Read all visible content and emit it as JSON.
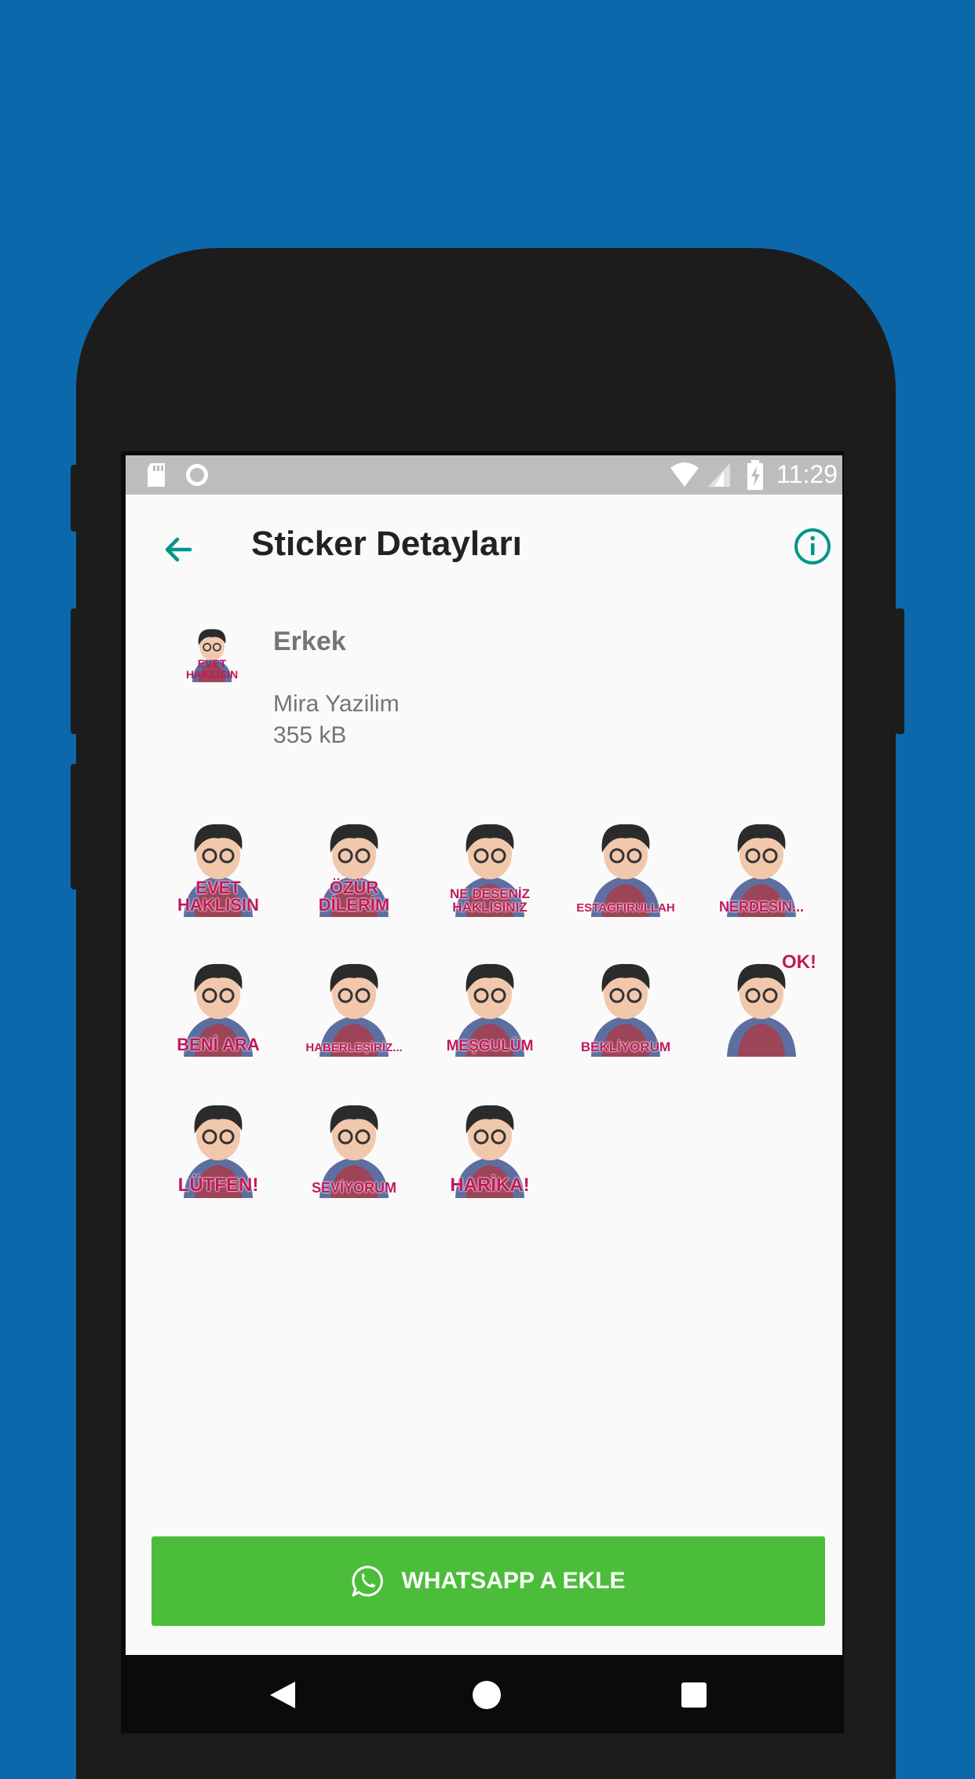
{
  "status_bar": {
    "time": "11:29"
  },
  "toolbar": {
    "title": "Sticker Detayları"
  },
  "pack": {
    "name": "Erkek",
    "publisher": "Mira Yazilim",
    "size": "355 kB",
    "tray_caption": "EVET HAKLISIN"
  },
  "stickers": [
    "EVET HAKLISIN",
    "ÖZÜR DİLERİM",
    "NE DESENİZ HAKLISINIZ",
    "ESTAGFIRULLAH",
    "NERDESİN...",
    "BENİ ARA",
    "HABERLEŞİRİZ...",
    "MEŞGULÜM",
    "BEKLİYORUM",
    "OK!",
    "LÜTFEN!",
    "SEVİYORUM",
    "HARİKA!"
  ],
  "add_button": {
    "label": "WHATSAPP A EKLE"
  },
  "colors": {
    "accent": "#009688",
    "button": "#4cbd3b",
    "caption": "#c2185b",
    "background": "#0b69ab"
  },
  "icons": {
    "back": "arrow-left-icon",
    "info": "info-circle-icon",
    "whatsapp": "whatsapp-icon"
  }
}
